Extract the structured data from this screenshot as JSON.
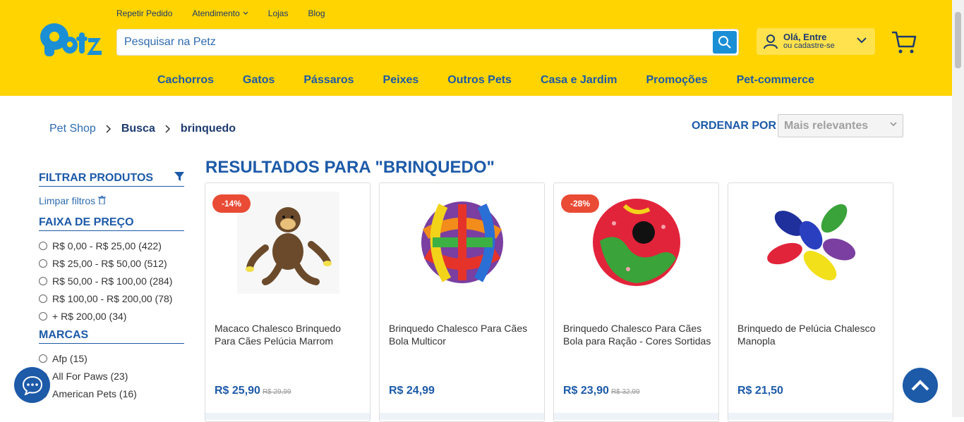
{
  "header": {
    "top_links": [
      "Repetir Pedido",
      "Atendimento",
      "Lojas",
      "Blog"
    ],
    "logo_text": "Petz",
    "search_placeholder": "Pesquisar na Petz",
    "account_line1": "Olá, Entre",
    "account_line2": "ou cadastre-se",
    "categories": [
      "Cachorros",
      "Gatos",
      "Pássaros",
      "Peixes",
      "Outros Pets",
      "Casa e Jardim",
      "Promoções",
      "Pet-commerce"
    ]
  },
  "breadcrumb": {
    "home": "Pet Shop",
    "section": "Busca",
    "current": "brinquedo"
  },
  "sort": {
    "label": "ORDENAR POR",
    "selected": "Mais relevantes"
  },
  "sidebar": {
    "filter_title": "FILTRAR PRODUTOS",
    "clear_label": "Limpar filtros",
    "price_title": "FAIXA DE PREÇO",
    "price_options": [
      "R$ 0,00 - R$ 25,00 (422)",
      "R$ 25,00 - R$ 50,00 (512)",
      "R$ 50,00 - R$ 100,00 (284)",
      "R$ 100,00 - R$ 200,00 (78)",
      "+ R$ 200,00 (34)"
    ],
    "brands_title": "MARCAS",
    "brand_options": [
      "Afp (15)",
      "All For Paws (23)",
      "American Pets (16)"
    ]
  },
  "results_title": "RESULTADOS PARA \"BRINQUEDO\"",
  "products": [
    {
      "badge": "-14%",
      "name": "Macaco Chalesco Brinquedo Para Cães Pelúcia Marrom",
      "price": "R$ 25,90",
      "old_price": "R$ 29,99"
    },
    {
      "badge": "",
      "name": "Brinquedo Chalesco Para Cães Bola Multicor",
      "price": "R$ 24,99",
      "old_price": ""
    },
    {
      "badge": "-28%",
      "name": "Brinquedo Chalesco Para Cães Bola para Ração - Cores Sortidas",
      "price": "R$ 23,90",
      "old_price": "R$ 32,99"
    },
    {
      "badge": "",
      "name": "Brinquedo de Pelúcia Chalesco Manopla",
      "price": "R$ 21,50",
      "old_price": ""
    }
  ],
  "colors": {
    "brand_yellow": "#ffd400",
    "brand_blue": "#1d5aa8",
    "discount_red": "#e94b35"
  }
}
